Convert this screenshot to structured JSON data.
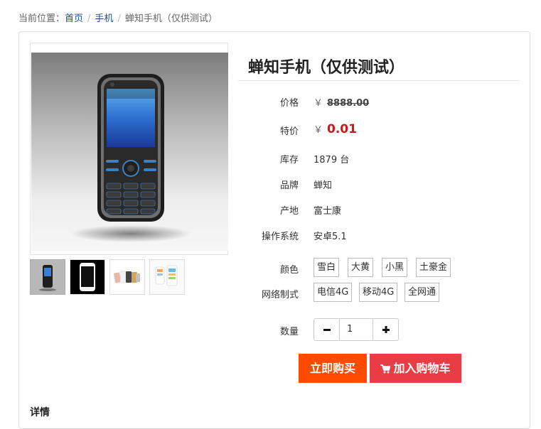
{
  "breadcrumb": {
    "prefix": "当前位置：",
    "items": [
      "首页",
      "手机",
      "蝉知手机（仅供测试）"
    ],
    "separator": "/"
  },
  "product": {
    "title": "蝉知手机（仅供测试）",
    "price_label": "价格",
    "price_currency": "￥",
    "price_value": "8888.00",
    "sale_label": "特价",
    "sale_currency": "￥",
    "sale_value": "0.01",
    "stock_label": "库存",
    "stock_value": "1879 台",
    "brand_label": "品牌",
    "brand_value": "蝉知",
    "origin_label": "产地",
    "origin_value": "富士康",
    "os_label": "操作系统",
    "os_value": "安卓5.1",
    "color_label": "颜色",
    "colors": [
      "雪白",
      "大黄",
      "小黑",
      "土豪金"
    ],
    "network_label": "网络制式",
    "networks": [
      "电信4G",
      "移动4G",
      "全网通"
    ],
    "qty_label": "数量",
    "qty_value": "1"
  },
  "buttons": {
    "buy_now": "立即购买",
    "add_to_cart": "加入购物车"
  },
  "detail": {
    "heading": "详情"
  },
  "colors": {
    "buy_bg": "#ff4a00",
    "cart_bg": "#e83d44",
    "sale_price": "#d0161b"
  }
}
